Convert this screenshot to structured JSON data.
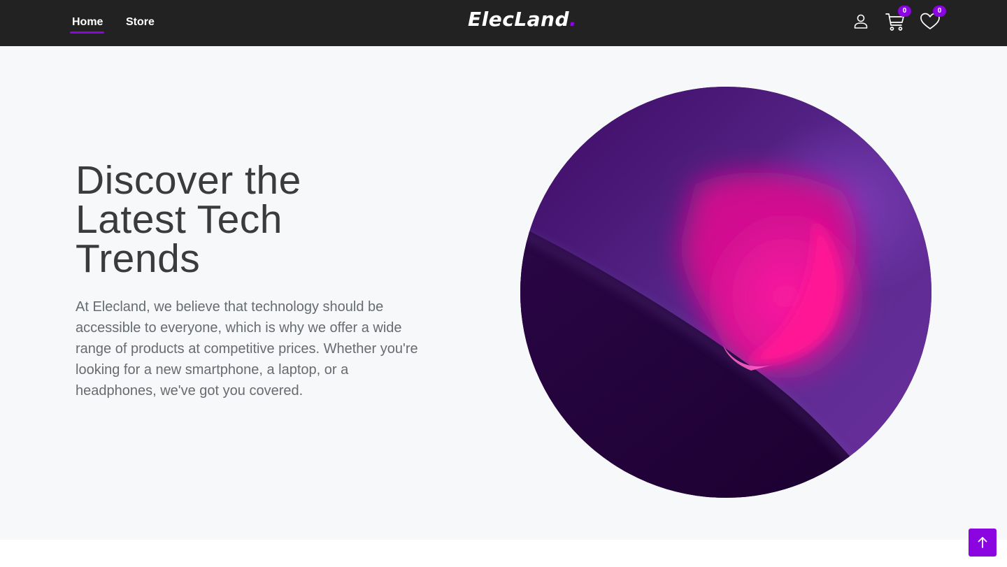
{
  "nav": {
    "links": [
      {
        "label": "Home",
        "active": true
      },
      {
        "label": "Store",
        "active": false
      }
    ],
    "logo_text": "ElecLand",
    "logo_dot": ".",
    "cart_count": "0",
    "wishlist_count": "0"
  },
  "hero": {
    "title": "Discover the Latest Tech Trends",
    "description": "At Elecland, we believe that technology should be accessible to everyone, which is why we offer a wide range of products at competitive prices. Whether you're looking for a new smartphone, a laptop, or a headphones, we've got you covered."
  },
  "icons": {
    "user": "user-icon",
    "cart": "cart-icon",
    "wishlist": "heart-icon",
    "scroll_top": "arrow-up-icon"
  },
  "colors": {
    "navbar": "#222222",
    "accent": "#8a05e0",
    "hero_background": "#f7f8fa",
    "title": "#3b3b3b",
    "body_text": "#676b70"
  }
}
